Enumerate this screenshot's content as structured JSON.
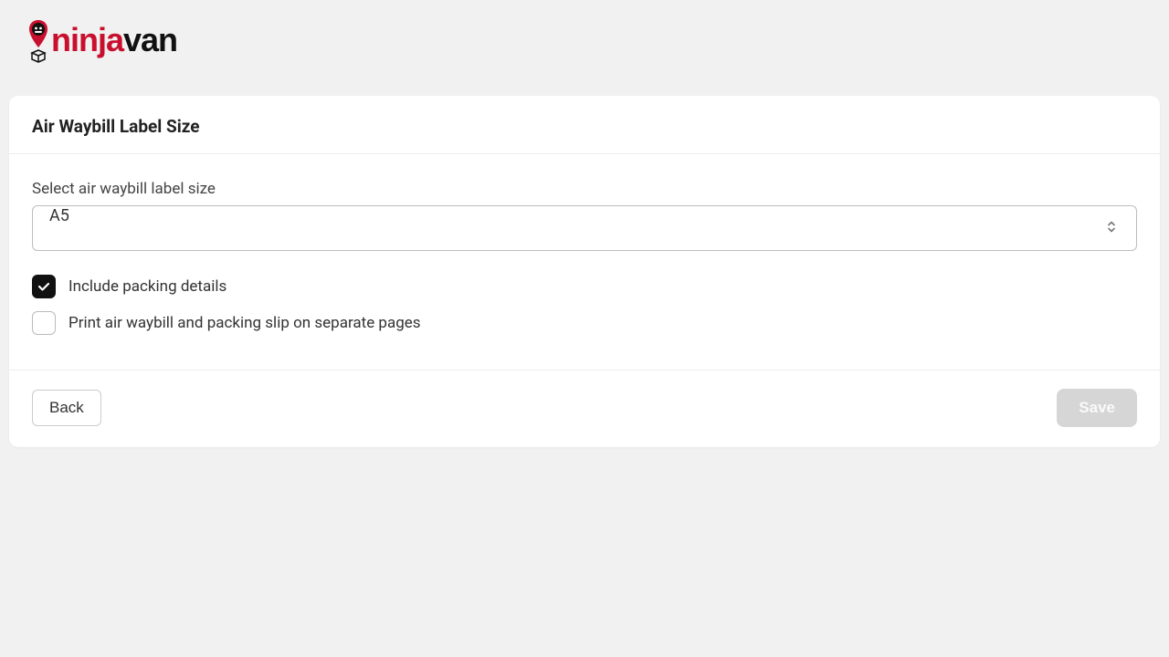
{
  "brand": {
    "text_ninja": "ninja",
    "text_van": "van"
  },
  "card": {
    "title": "Air Waybill Label Size"
  },
  "form": {
    "size_label": "Select air waybill label size",
    "size_value": "A5",
    "include_packing": {
      "label": "Include packing details",
      "checked": true
    },
    "separate_pages": {
      "label": "Print air waybill and packing slip on separate pages",
      "checked": false
    }
  },
  "actions": {
    "back": "Back",
    "save": "Save"
  }
}
